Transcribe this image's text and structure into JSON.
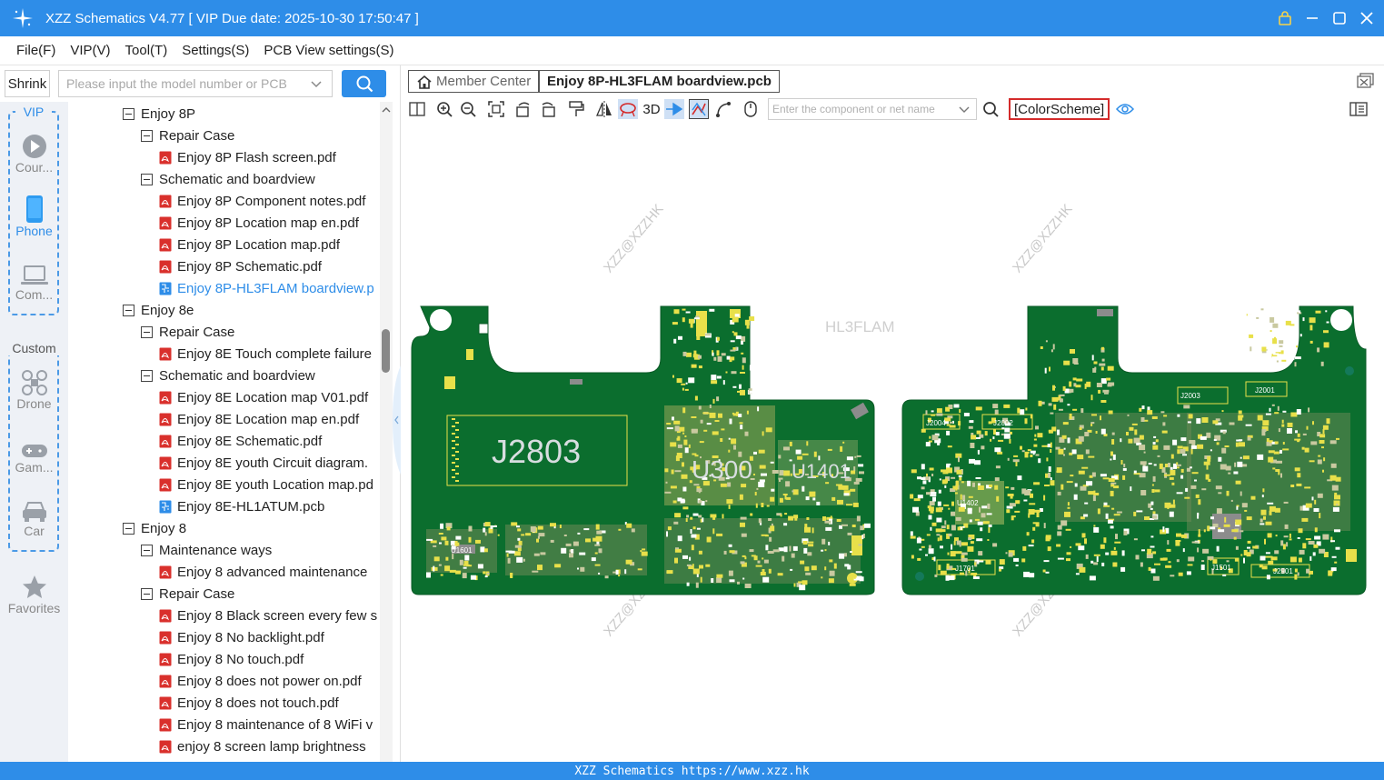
{
  "window": {
    "title": "XZZ Schematics V4.77 [ VIP Due date: 2025-10-30 17:50:47 ]"
  },
  "menu": [
    "File(F)",
    "VIP(V)",
    "Tool(T)",
    "Settings(S)",
    "PCB View settings(S)"
  ],
  "sidebar": {
    "shrink_label": "Shrink",
    "search_placeholder": "Please input the model number or PCB",
    "vip_label": "VIP",
    "custom_label": "Custom",
    "categories": [
      "Cour...",
      "Phone",
      "Com...",
      "Drone",
      "Gam...",
      "Car",
      "Favorites"
    ]
  },
  "tree": [
    {
      "level": 0,
      "type": "folder",
      "label": "Enjoy 8P"
    },
    {
      "level": 1,
      "type": "folder",
      "label": "Repair Case"
    },
    {
      "level": 2,
      "type": "pdf",
      "label": "Enjoy 8P Flash screen.pdf"
    },
    {
      "level": 1,
      "type": "folder",
      "label": "Schematic and boardview"
    },
    {
      "level": 2,
      "type": "pdf",
      "label": "Enjoy 8P Component notes.pdf"
    },
    {
      "level": 2,
      "type": "pdf",
      "label": "Enjoy 8P Location map en.pdf"
    },
    {
      "level": 2,
      "type": "pdf",
      "label": "Enjoy 8P Location map.pdf"
    },
    {
      "level": 2,
      "type": "pdf",
      "label": "Enjoy 8P Schematic.pdf"
    },
    {
      "level": 2,
      "type": "pcb",
      "label": "Enjoy 8P-HL3FLAM boardview.p",
      "selected": true
    },
    {
      "level": 0,
      "type": "folder",
      "label": "Enjoy 8e"
    },
    {
      "level": 1,
      "type": "folder",
      "label": "Repair Case"
    },
    {
      "level": 2,
      "type": "pdf",
      "label": "Enjoy 8E Touch complete failure"
    },
    {
      "level": 1,
      "type": "folder",
      "label": "Schematic and boardview"
    },
    {
      "level": 2,
      "type": "pdf",
      "label": "Enjoy 8E Location map V01.pdf"
    },
    {
      "level": 2,
      "type": "pdf",
      "label": "Enjoy 8E Location map en.pdf"
    },
    {
      "level": 2,
      "type": "pdf",
      "label": "Enjoy 8E Schematic.pdf"
    },
    {
      "level": 2,
      "type": "pdf",
      "label": "Enjoy 8E youth Circuit diagram."
    },
    {
      "level": 2,
      "type": "pdf",
      "label": "Enjoy 8E youth Location map.pd"
    },
    {
      "level": 2,
      "type": "pcb",
      "label": "Enjoy 8E-HL1ATUM.pcb"
    },
    {
      "level": 0,
      "type": "folder",
      "label": "Enjoy 8"
    },
    {
      "level": 1,
      "type": "folder",
      "label": "Maintenance ways"
    },
    {
      "level": 2,
      "type": "pdf",
      "label": "Enjoy 8 advanced maintenance"
    },
    {
      "level": 1,
      "type": "folder",
      "label": "Repair Case"
    },
    {
      "level": 2,
      "type": "pdf",
      "label": "Enjoy 8 Black screen every few s"
    },
    {
      "level": 2,
      "type": "pdf",
      "label": "Enjoy 8 No backlight.pdf"
    },
    {
      "level": 2,
      "type": "pdf",
      "label": "Enjoy 8 No touch.pdf"
    },
    {
      "level": 2,
      "type": "pdf",
      "label": "Enjoy 8 does not power on.pdf"
    },
    {
      "level": 2,
      "type": "pdf",
      "label": "Enjoy 8 does not touch.pdf"
    },
    {
      "level": 2,
      "type": "pdf",
      "label": "Enjoy 8 maintenance of 8 WiFi v"
    },
    {
      "level": 2,
      "type": "pdf",
      "label": "enjoy 8 screen lamp brightness"
    }
  ],
  "tabs": {
    "member_center": "Member Center",
    "active_file": "Enjoy 8P-HL3FLAM boardview.pcb"
  },
  "pcb_toolbar": {
    "three_d_label": "3D",
    "search_placeholder": "Enter the component or net name",
    "colorscheme_label": "[ColorScheme]"
  },
  "board": {
    "board_name": "HL3FLAM",
    "watermark": "XZZ@XZZHK",
    "labels_front": [
      "J2803",
      "U300",
      "U1401",
      "U1601"
    ],
    "labels_back": [
      "J2004",
      "J2002",
      "J2003",
      "J2001",
      "U1402",
      "J1701",
      "J1501",
      "J2901"
    ],
    "pcb_color": "#0b6e2e",
    "pad_color": "#e8e04a"
  },
  "status_text": "XZZ Schematics https://www.xzz.hk",
  "colors": {
    "accent": "#2e8de8",
    "pdf_red": "#d9302c"
  }
}
